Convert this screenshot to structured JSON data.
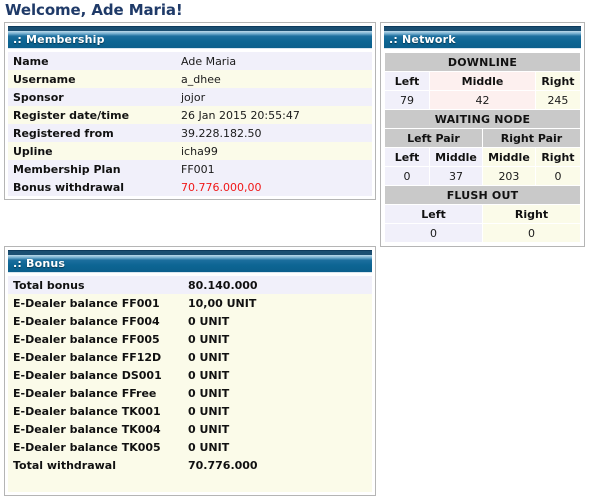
{
  "page": {
    "welcome_heading": "Welcome, Ade Maria!"
  },
  "colors": {
    "heading": "#1f3a68",
    "panel_header_start": "#bcd9ea",
    "panel_header_end": "#0b5f8c",
    "alert_red": "#f01818",
    "row_lavender": "#f1f0fa",
    "row_cream": "#fbfbe9",
    "row_pink": "#fdf0ef",
    "section_gray": "#c9c9c9"
  },
  "membership": {
    "title": ".: Membership",
    "rows": [
      {
        "label": "Name",
        "value": "Ade Maria"
      },
      {
        "label": "Username",
        "value": "a_dhee"
      },
      {
        "label": "Sponsor",
        "value": "jojor"
      },
      {
        "label": "Register date/time",
        "value": "26 Jan 2015 20:55:47"
      },
      {
        "label": "Registered from",
        "value": "39.228.182.50"
      },
      {
        "label": "Upline",
        "value": "icha99"
      },
      {
        "label": "Membership Plan",
        "value": "FF001"
      },
      {
        "label": "Bonus withdrawal",
        "value": "70.776.000,00"
      }
    ]
  },
  "network": {
    "title": ".: Network",
    "downline": {
      "section_label": "DOWNLINE",
      "headers": [
        "Left",
        "Middle",
        "Right"
      ],
      "values": [
        "79",
        "42",
        "245"
      ]
    },
    "waiting_node": {
      "section_label": "WAITING NODE",
      "pair_labels": [
        "Left Pair",
        "Right Pair"
      ],
      "headers": [
        "Left",
        "Middle",
        "Middle",
        "Right"
      ],
      "values": [
        "0",
        "37",
        "203",
        "0"
      ]
    },
    "flush_out": {
      "section_label": "FLUSH OUT",
      "headers": [
        "Left",
        "Right"
      ],
      "values": [
        "0",
        "0"
      ]
    }
  },
  "bonus": {
    "title": ".: Bonus",
    "rows": [
      {
        "label": "Total bonus",
        "value": "80.140.000"
      },
      {
        "label": "E-Dealer balance FF001",
        "value": "10,00 UNIT"
      },
      {
        "label": "E-Dealer balance FF004",
        "value": "0 UNIT"
      },
      {
        "label": "E-Dealer balance FF005",
        "value": "0 UNIT"
      },
      {
        "label": "E-Dealer balance FF12D",
        "value": "0 UNIT"
      },
      {
        "label": "E-Dealer balance DS001",
        "value": "0 UNIT"
      },
      {
        "label": "E-Dealer balance FFree",
        "value": "0 UNIT"
      },
      {
        "label": "E-Dealer balance TK001",
        "value": "0 UNIT"
      },
      {
        "label": "E-Dealer balance TK004",
        "value": "0 UNIT"
      },
      {
        "label": "E-Dealer balance TK005",
        "value": "0 UNIT"
      },
      {
        "label": "Total withdrawal",
        "value": "70.776.000"
      }
    ]
  }
}
